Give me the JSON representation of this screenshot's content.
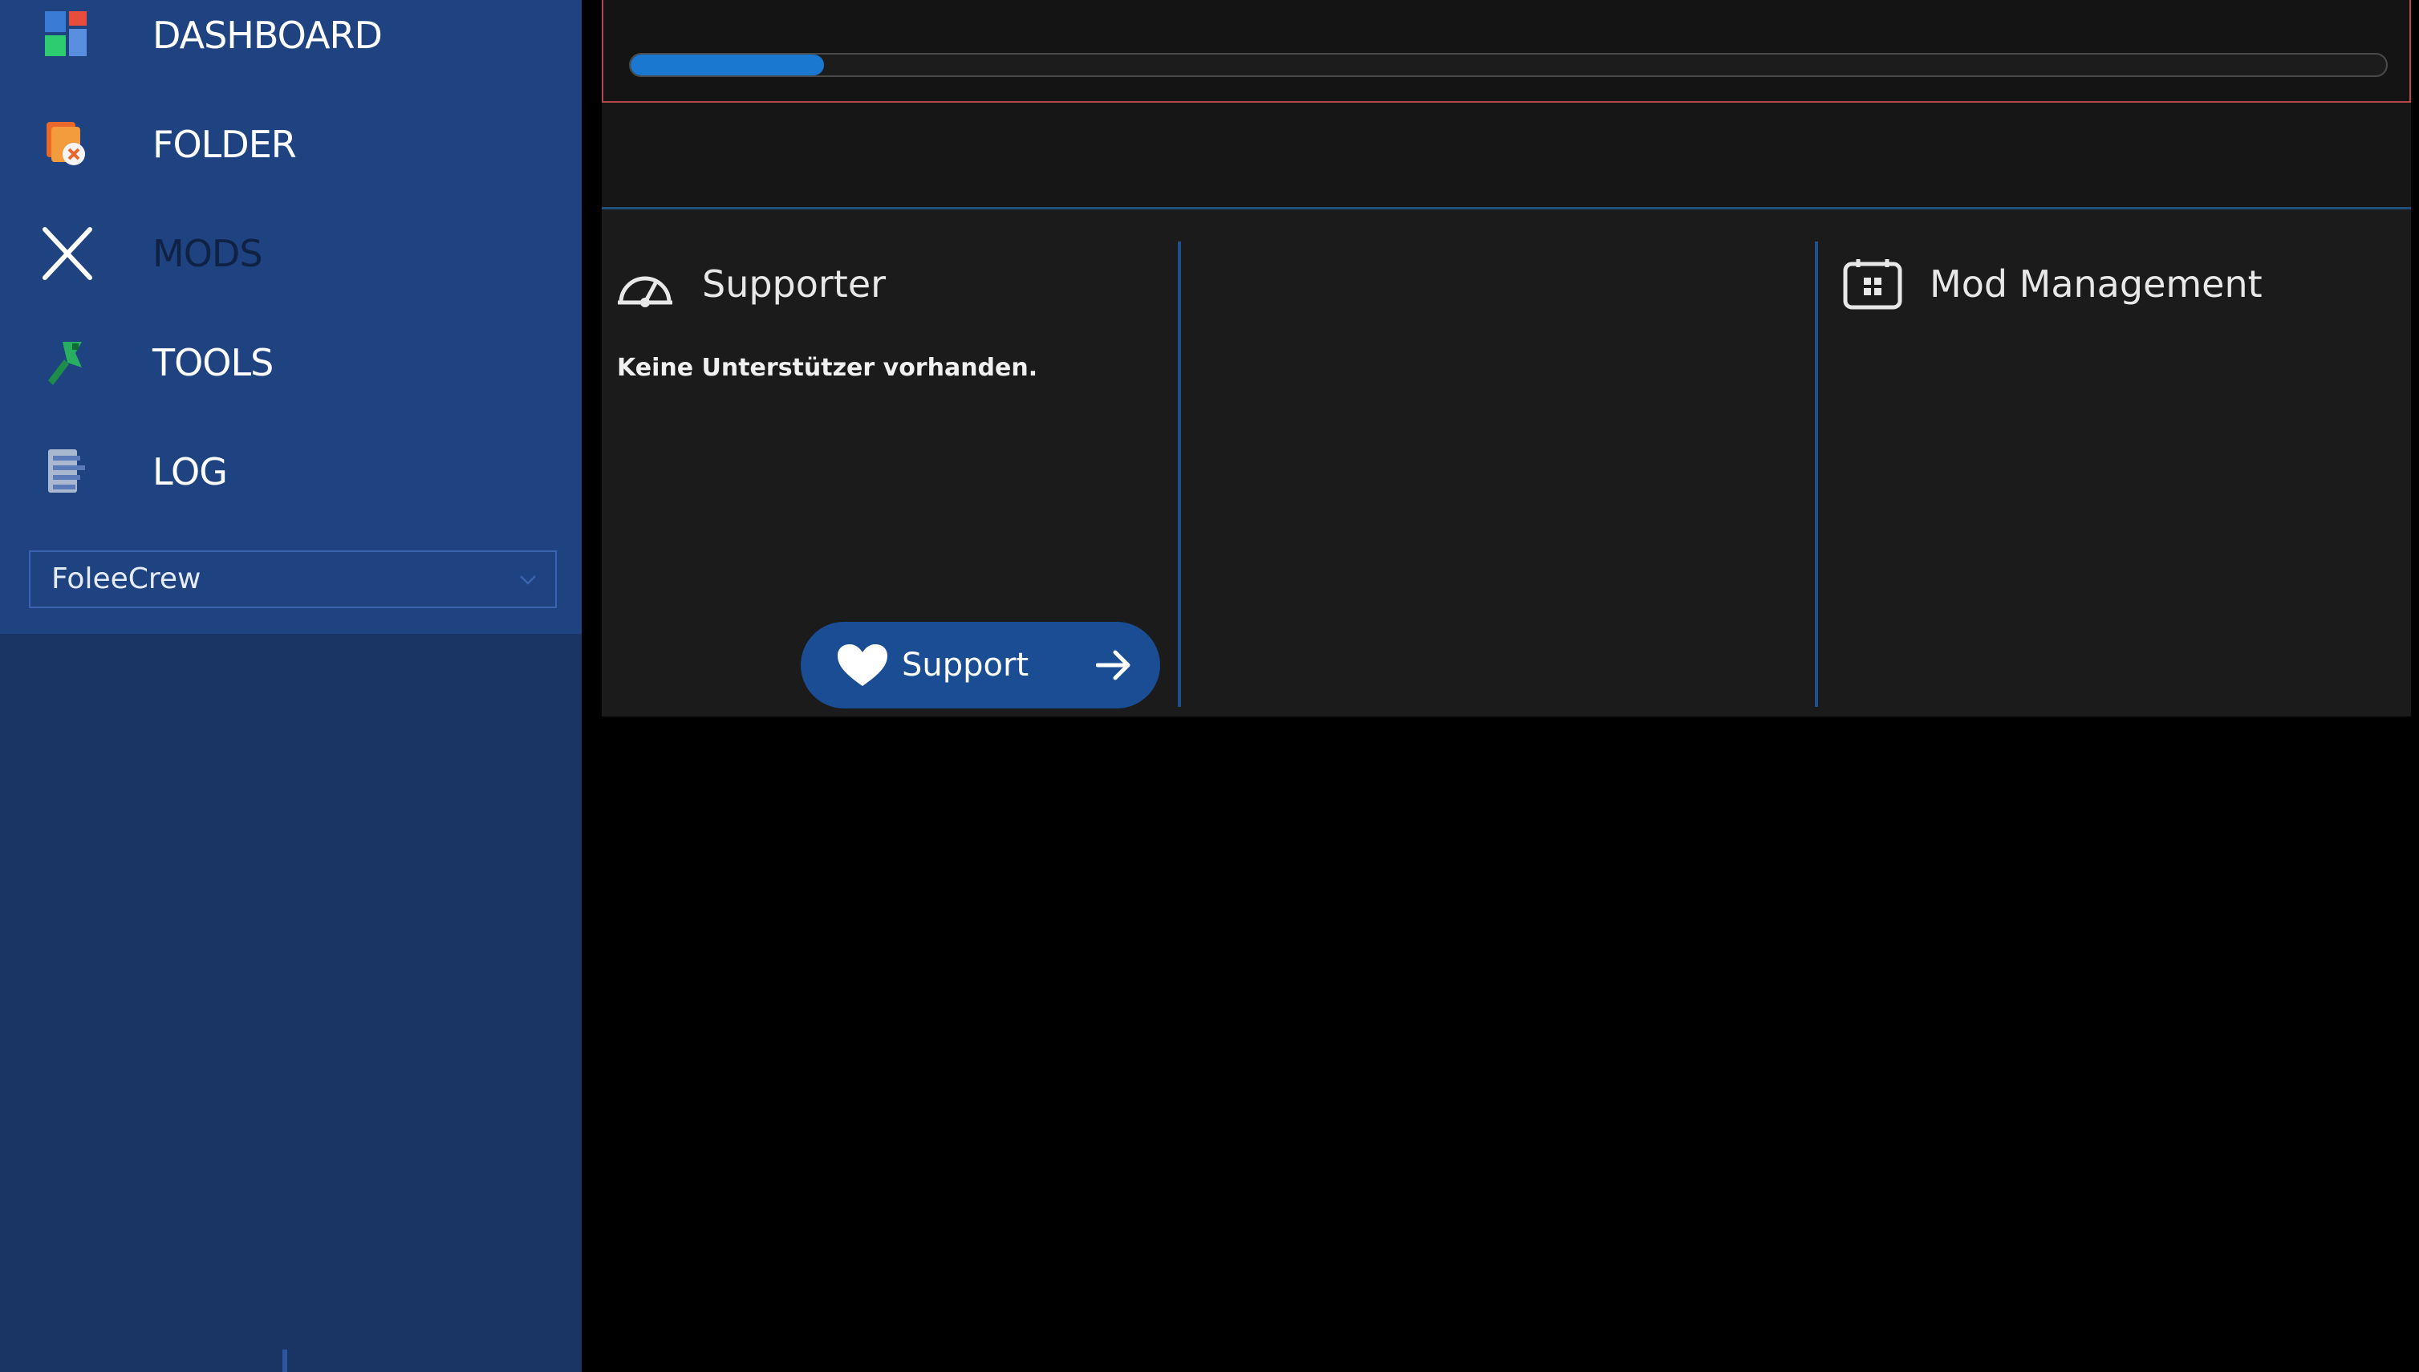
{
  "sidebar": {
    "items": [
      {
        "label": "DASHBOARD",
        "icon": "dashboard-icon"
      },
      {
        "label": "FOLDER",
        "icon": "folder-icon"
      },
      {
        "label": "MODS",
        "icon": "close-icon"
      },
      {
        "label": "TOOLS",
        "icon": "tools-icon"
      },
      {
        "label": "LOG",
        "icon": "log-icon"
      }
    ],
    "crew_select": {
      "value": "FoleeCrew",
      "icon": "chevron-down-icon"
    }
  },
  "progress": {
    "value": 0.11,
    "color": "#1a78d0"
  },
  "supporter": {
    "title": "Supporter",
    "icon": "speedometer-icon",
    "message": "Keine Unterstützer vorhanden.",
    "button": {
      "label": "Support",
      "icon": "heart-icon",
      "arrow_icon": "arrow-right-icon"
    }
  },
  "mod_management": {
    "title": "Mod Management",
    "icon": "grid-box-icon"
  },
  "colors": {
    "sidebar": "#1f4381",
    "sidebar_lower": "#1a3564",
    "accent": "#1a78d0",
    "alert_border": "#b74848"
  }
}
